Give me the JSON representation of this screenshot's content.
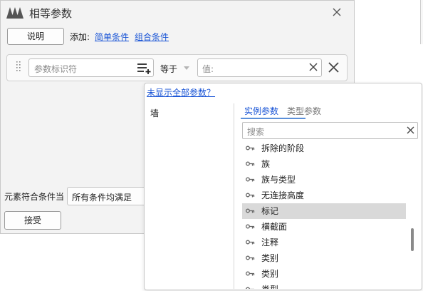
{
  "dialog": {
    "title": "相等参数",
    "explain_button": "说明",
    "add_label": "添加:",
    "add_simple_link": "简单条件",
    "add_group_link": "组合条件",
    "condition_row": {
      "param_placeholder": "参数标识符",
      "operator": "等于",
      "value_placeholder": "值:"
    },
    "match_label": "元素符合条件当",
    "match_value": "所有条件均满足",
    "accept_button": "接受"
  },
  "popup": {
    "show_all_link": "未显示全部参数？",
    "category": "墙",
    "tabs": [
      {
        "label": "实例参数",
        "active": true
      },
      {
        "label": "类型参数",
        "active": false
      }
    ],
    "search_placeholder": "搜索",
    "items": [
      {
        "label": "拆除的阶段",
        "selected": false
      },
      {
        "label": "族",
        "selected": false
      },
      {
        "label": "族与类型",
        "selected": false
      },
      {
        "label": "无连接高度",
        "selected": false
      },
      {
        "label": "标记",
        "selected": true
      },
      {
        "label": "横截面",
        "selected": false
      },
      {
        "label": "注释",
        "selected": false
      },
      {
        "label": "类别",
        "selected": false
      },
      {
        "label": "类别",
        "selected": false
      },
      {
        "label": "类型",
        "selected": false
      }
    ]
  },
  "icons": {
    "logo": "app-logo-icon",
    "close": "close-icon",
    "grip": "drag-grip-icon",
    "add_list": "add-list-icon",
    "dropdown": "chevron-down-icon",
    "clear": "clear-icon",
    "delete": "delete-icon",
    "param_item": "key-icon"
  },
  "colors": {
    "link": "#1a55d6",
    "tab_active": "#1a55d6",
    "selected_row": "#d9d9d9",
    "logo": "#555555"
  }
}
